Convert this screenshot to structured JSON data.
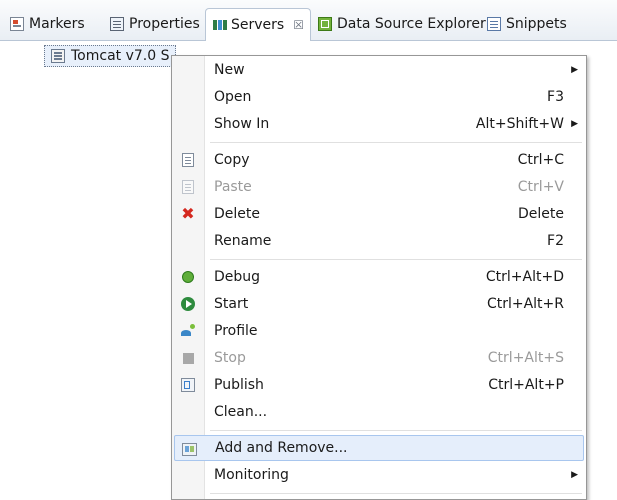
{
  "tabs": [
    {
      "label": "Markers",
      "icon": "markers-icon"
    },
    {
      "label": "Properties",
      "icon": "properties-icon"
    },
    {
      "label": "Servers",
      "icon": "servers-icon",
      "active": true,
      "close": "☒"
    },
    {
      "label": "Data Source Explorer",
      "icon": "data-source-explorer-icon"
    },
    {
      "label": "Snippets",
      "icon": "snippets-icon"
    }
  ],
  "server": {
    "label": "Tomcat v7.0 S"
  },
  "menu": {
    "items": [
      {
        "label": "New",
        "shortcut": "",
        "submenu": true
      },
      {
        "label": "Open",
        "shortcut": "F3"
      },
      {
        "label": "Show In",
        "shortcut": "Alt+Shift+W",
        "submenu": true
      },
      {
        "label": "Copy",
        "shortcut": "Ctrl+C",
        "icon": "copy-icon"
      },
      {
        "label": "Paste",
        "shortcut": "Ctrl+V",
        "icon": "paste-icon",
        "disabled": true
      },
      {
        "label": "Delete",
        "shortcut": "Delete",
        "icon": "delete-icon"
      },
      {
        "label": "Rename",
        "shortcut": "F2"
      },
      {
        "label": "Debug",
        "shortcut": "Ctrl+Alt+D",
        "icon": "debug-icon"
      },
      {
        "label": "Start",
        "shortcut": "Ctrl+Alt+R",
        "icon": "start-icon"
      },
      {
        "label": "Profile",
        "shortcut": "",
        "icon": "profile-icon"
      },
      {
        "label": "Stop",
        "shortcut": "Ctrl+Alt+S",
        "icon": "stop-icon",
        "disabled": true
      },
      {
        "label": "Publish",
        "shortcut": "Ctrl+Alt+P",
        "icon": "publish-icon"
      },
      {
        "label": "Clean...",
        "shortcut": ""
      },
      {
        "label": "Add and Remove...",
        "shortcut": "",
        "icon": "add-remove-icon",
        "highlighted": true
      },
      {
        "label": "Monitoring",
        "shortcut": "",
        "submenu": true
      }
    ],
    "submenu_arrow": "▶"
  },
  "colors": {
    "menu_hover_bg": "#e5eefb",
    "menu_hover_border": "#a8c6ee",
    "disabled_text": "#9a9a9a",
    "delete_red": "#d4281f"
  }
}
